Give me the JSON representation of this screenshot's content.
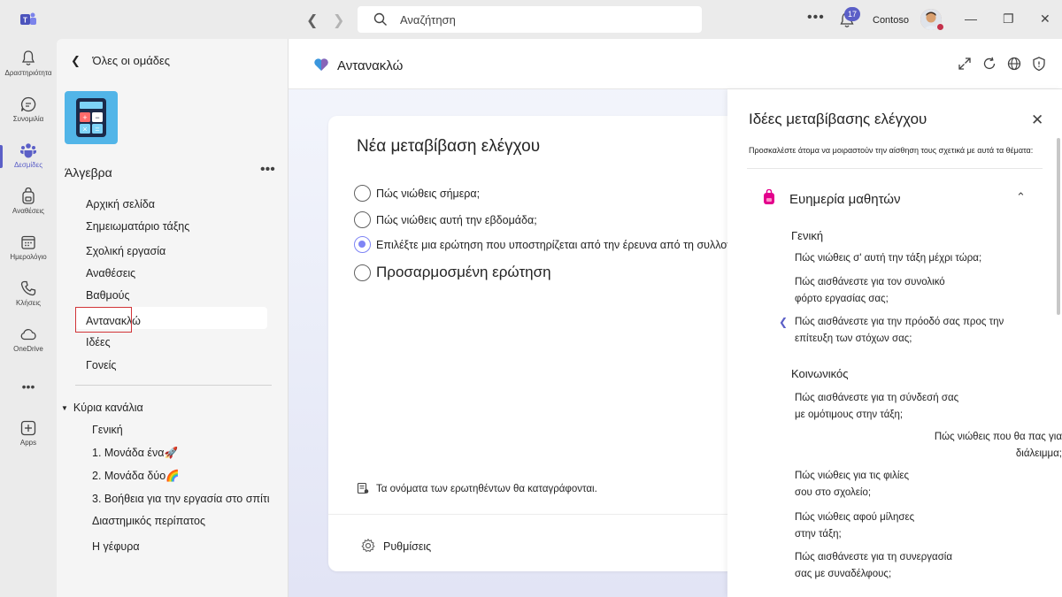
{
  "titlebar": {
    "search_placeholder": "Αναζήτηση",
    "notification_count": "17",
    "org_name": "Contoso"
  },
  "rail": {
    "items": [
      {
        "label": "Δραστηριότητα",
        "icon": "bell-icon"
      },
      {
        "label": "Συνομιλία",
        "icon": "chat-icon"
      },
      {
        "label": "Δεσμίδες",
        "icon": "teams-icon"
      },
      {
        "label": "Αναθέσεις",
        "icon": "backpack-icon"
      },
      {
        "label": "Ημερολόγιο",
        "icon": "calendar-icon"
      },
      {
        "label": "Κλήσεις",
        "icon": "phone-icon"
      },
      {
        "label": "OneDrive",
        "icon": "cloud-icon"
      },
      {
        "label": "Apps",
        "icon": "add-apps-icon"
      }
    ]
  },
  "sidebar": {
    "back_label": "Όλες οι ομάδες",
    "team_name": "Άλγεβρα",
    "tabs": [
      "Αρχική σελίδα",
      "Σημειωματάριο τάξης",
      "Σχολική εργασία",
      "Αναθέσεις",
      "Βαθμούς",
      "Αντανακλώ",
      "Ιδέες",
      "Γονείς"
    ],
    "channels_header": "Κύρια κανάλια",
    "channels": [
      "Γενική",
      "1. Μονάδα ένα🚀",
      "2. Μονάδα δύο🌈",
      "3. Βοήθεια για την εργασία στο σπίτι",
      "Διαστημικός περίπατος",
      "Η γέφυρα"
    ]
  },
  "main": {
    "app_title": "Αντανακλώ",
    "card": {
      "title": "Νέα μεταβίβαση ελέγχου",
      "options": [
        "Πώς νιώθεις σήμερα;",
        "Πώς νιώθεις αυτή την εβδομάδα;",
        "Επιλέξτε μια ερώτηση που υποστηρίζεται από την έρευνα από τη συλλογή",
        "Προσαρμοσμένη ερώτηση"
      ],
      "selected_option": 2,
      "record_note": "Τα ονόματα των ερωτηθέντων θα καταγράφονται.",
      "settings_label": "Ρυθμίσεις"
    }
  },
  "ideas": {
    "title": "Ιδέες μεταβίβασης ελέγχου",
    "subtitle": "Προσκαλέστε άτομα να μοιραστούν την αίσθηση τους σχετικά με αυτά τα θέματα:",
    "section_title": "Ευημερία μαθητών",
    "categories": [
      {
        "name": "Γενική",
        "questions": [
          "Πώς νιώθεις σ' αυτή την τάξη μέχρι τώρα;",
          "Πώς αισθάνεστε για τον συνολικό φόρτο εργασίας σας;",
          "Πώς αισθάνεστε για την πρόοδό σας προς την επίτευξη των στόχων σας;"
        ]
      },
      {
        "name": "Κοινωνικός",
        "questions": [
          "Πώς αισθάνεστε για τη σύνδεσή σας με ομότιμους στην τάξη;",
          "Πώς νιώθεις που θα πας για διάλειμμα;",
          "Πώς νιώθεις για τις φιλίες σου στο σχολείο;",
          "Πώς νιώθεις αφού μίλησες στην τάξη;",
          "Πώς αισθάνεστε για τη συνεργασία σας με συναδέλφους;"
        ]
      }
    ]
  },
  "colors": {
    "accent": "#5b5fc7",
    "radio_selected": "#7f85f5",
    "highlight_border": "#d13438"
  }
}
